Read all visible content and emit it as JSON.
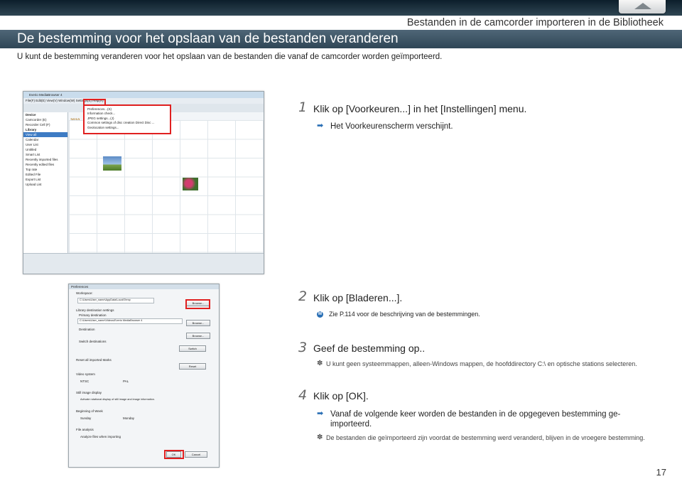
{
  "header": {
    "breadcrumb": "Bestanden in de camcorder importeren in de Bibliotheek",
    "title": "De bestemming voor het opslaan van de bestanden veranderen",
    "intro": "U kunt de bestemming veranderen voor het opslaan van de bestanden die vanaf de camcorder worden geïmporteerd.",
    "home_icon": "home-triangle-icon"
  },
  "screenshot1": {
    "window_title": "Everio MediaBrowser 4",
    "menubar": "File(F)   Edit(E)   View(V)   Window(W)   Settings(S)   Help(H)",
    "dropdown": [
      "Preferences...(S)",
      "Information check...",
      "JPEG settings...(J)",
      "Common settings of disc creation  Direct Disc ...",
      "Geolocation settings..."
    ],
    "side": [
      "Device",
      "Camcorder (E)",
      "Recorder Cell (F)",
      "Library",
      "View all",
      "Calendar",
      "User List",
      "Untitled",
      "Smart List",
      "Recently imported files",
      "Recently edited files",
      "Top rate",
      "Edited File",
      "Export List",
      "Upload List"
    ],
    "year": "2010"
  },
  "screenshot2": {
    "window_title": "Preferences",
    "workspace": "Workspace:",
    "workspace_path": "C:\\Users\\User_name\\AppData\\Local\\Temp",
    "library_dest": "Library destination settings",
    "primary_dest": "Primary destination",
    "primary_path": "C:\\Users\\User_name\\Videos\\Everio MediaBrowser 4",
    "destination": "Destination",
    "switch_dest": "Switch destinations",
    "reset_marks": "Reset all imported Marks",
    "video_system": "Video system",
    "ntsc": "NTSC",
    "pal": "PAL",
    "still_image": "Still image display",
    "rotation": "Activate rotational display of still image and image information.",
    "week": "Beginning of Week",
    "sunday": "Sunday",
    "monday": "Monday",
    "file_analysis": "File analysis",
    "analyze": "Analyze files when importing",
    "browse": "Browse...",
    "switch": "Switch",
    "reset": "Reset",
    "ok": "OK",
    "cancel": "Cancel"
  },
  "steps": [
    {
      "num": "1",
      "text": "Klik op [Voorkeuren...] in het [Instellingen] menu.",
      "result": "Het Voorkeurenscherm verschijnt."
    },
    {
      "num": "2",
      "text": "Klik op [Bladeren...].",
      "ref": "Zie P.114 voor de beschrijving van de bestemmingen."
    },
    {
      "num": "3",
      "text": "Geef de bestemming op..",
      "note": "U kunt geen systeemmappen, alleen-Windows mappen, de hoofddirectory C:\\ en optische stations selecteren."
    },
    {
      "num": "4",
      "text": "Klik op [OK].",
      "result_line1": "Vanaf de volgende keer worden de bestanden in de opgegeven bestemming ge-",
      "result_line2": "importeerd.",
      "note": "De bestanden die geïmporteerd zijn voordat de bestemming werd veranderd, blijven in de vroegere bestemming."
    }
  ],
  "page_number": "17"
}
